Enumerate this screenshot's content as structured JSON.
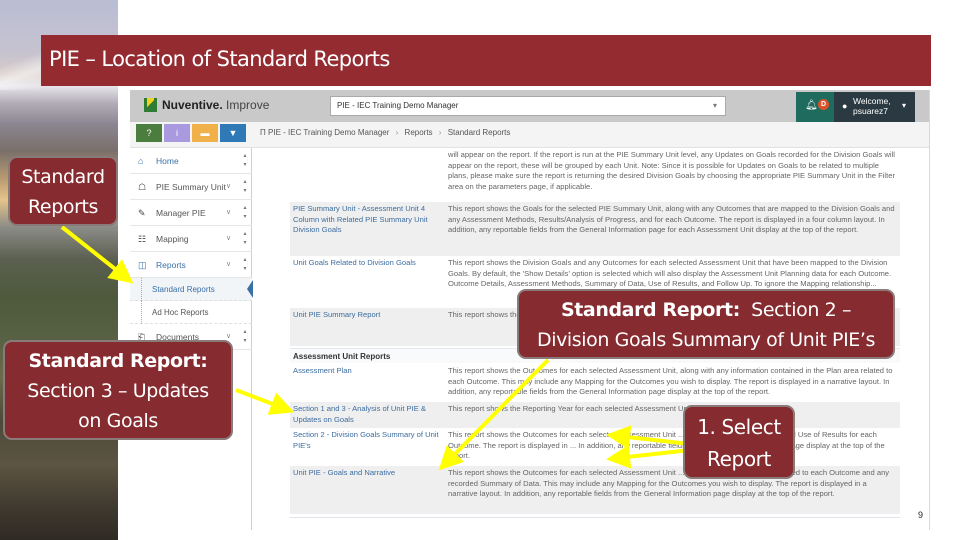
{
  "slide": {
    "title": "PIE – Location of Standard Reports",
    "page_number": "9"
  },
  "app": {
    "brand_bold": "Nuventive.",
    "brand_light": " Improve",
    "context_select": {
      "value": "PIE - IEC Training Demo Manager",
      "caret": "▾"
    },
    "notifications": {
      "icon": "bell-icon",
      "badge": "D"
    },
    "user": {
      "welcome_line1": "Welcome,",
      "welcome_line2": "psuarez7",
      "caret": "▾"
    },
    "quick_buttons": [
      {
        "name": "help",
        "glyph": "?",
        "color": "#4b7d3f"
      },
      {
        "name": "info",
        "glyph": "i",
        "color": "#a99ae0"
      },
      {
        "name": "panel",
        "glyph": "▬",
        "color": "#f0b14a"
      },
      {
        "name": "filter",
        "glyph": "▼",
        "color": "#2f79b6"
      }
    ],
    "breadcrumb": {
      "icon": "Π",
      "items": [
        "PIE - IEC Training Demo Manager",
        "Reports",
        "Standard Reports"
      ],
      "separator": "›"
    },
    "sidebar": {
      "items": [
        {
          "label": "Home",
          "icon": "⌂",
          "chevron": ""
        },
        {
          "label": "PIE Summary Unit",
          "icon": "⌂",
          "chevron": "∨"
        },
        {
          "label": "Manager PIE",
          "icon": "✎",
          "chevron": "∨"
        },
        {
          "label": "Mapping",
          "icon": "☷",
          "chevron": "∨"
        },
        {
          "label": "Reports",
          "icon": "◫",
          "chevron": "∨"
        },
        {
          "label": "Documents",
          "icon": "⎗",
          "chevron": "∨"
        }
      ],
      "sub_items": [
        {
          "label": "Standard Reports"
        },
        {
          "label": "Ad Hoc Reports"
        }
      ],
      "scroll_glyph": "▴\n▾"
    },
    "reports": {
      "top_rows": [
        {
          "name": "",
          "desc": "will appear on the report. If the report is run at the PIE Summary Unit level, any Updates on Goals recorded for the Division Goals will appear on the report, these will be grouped by each Unit. Note: Since it is possible for Updates on Goals to be related to multiple plans, please make sure the report is returning the desired Division Goals by choosing the appropriate PIE Summary Unit in the Filter area on the parameters page, if applicable."
        },
        {
          "name": "PIE Summary Unit - Assessment Unit 4 Column with Related PIE Summary Unit Division Goals",
          "desc": "This report shows the Goals for the selected PIE Summary Unit, along with any Outcomes that are mapped to the Division Goals and any Assessment Methods, Results/Analysis of Progress, and for each Outcome. The report is displayed in a four column layout. In addition, any reportable fields from the General Information page for each Assessment Unit display at the top of the report."
        },
        {
          "name": "Unit Goals Related to Division Goals",
          "desc": "This report shows the Division Goals and any Outcomes for each selected Assessment Unit that have been mapped to the Division Goals. By default, the 'Show Details' option is selected which will also display the Assessment Unit Planning data for each Outcome. Outcome Details, Assessment Methods, Summary of Data, Use of Results, and Follow Up. To ignore the Mapping relationship..."
        },
        {
          "name": "Unit PIE Summary Report",
          "desc": "This report shows the ... Methods, Summary of Data ... related Assessment ... the"
        }
      ],
      "section_title": "Assessment Unit Reports",
      "section_rows": [
        {
          "name": "Assessment Plan",
          "desc": "This report shows the Outcomes for each selected Assessment Unit, along with any information contained in the Plan area related to each Outcome. This may include any Mapping for the Outcomes you wish to display. The report is displayed in a narrative layout. In addition, any reportable fields from the General Information page display at the top of the report."
        },
        {
          "name": "Section 1 and 3 - Analysis of Unit PIE & Updates on Goals",
          "desc": "This report shows the Reporting Year for each selected Assessment Unit ..."
        },
        {
          "name": "Section 2 - Division Goals Summary of Unit PIE's",
          "desc": "This report shows the Outcomes for each selected Assessment Unit ... Methods, Summary of Data, and Use of Results for each Outcome. The report is displayed in ... In addition, any reportable fields from the General Information page display at the top of the report."
        },
        {
          "name": "Unit PIE - Goals and Narrative",
          "desc": "This report shows the Outcomes for each selected Assessment Unit ... contained in the Plan area related to each Outcome and any recorded Summary of Data. This may include any Mapping for the Outcomes you wish to display. The report is displayed in a narrative layout. In addition, any reportable fields from the General Information page display at the top of the report."
        }
      ]
    }
  },
  "callouts": {
    "standard_reports": {
      "line1": "Standard",
      "line2": "Reports"
    },
    "section3": {
      "bold": "Standard Report:",
      "line2": "Section 3 – Updates",
      "line3": "on Goals"
    },
    "section2": {
      "bold": "Standard Report:",
      "rest": "  Section 2 –",
      "line2": "Division Goals Summary of Unit PIE’s"
    },
    "select": {
      "line1": "1. Select",
      "line2": "Report"
    }
  },
  "colors": {
    "title_bar": "#932b31",
    "callout_fill": "#862b2f",
    "arrow": "#ffff00",
    "link": "#3c6da0"
  }
}
